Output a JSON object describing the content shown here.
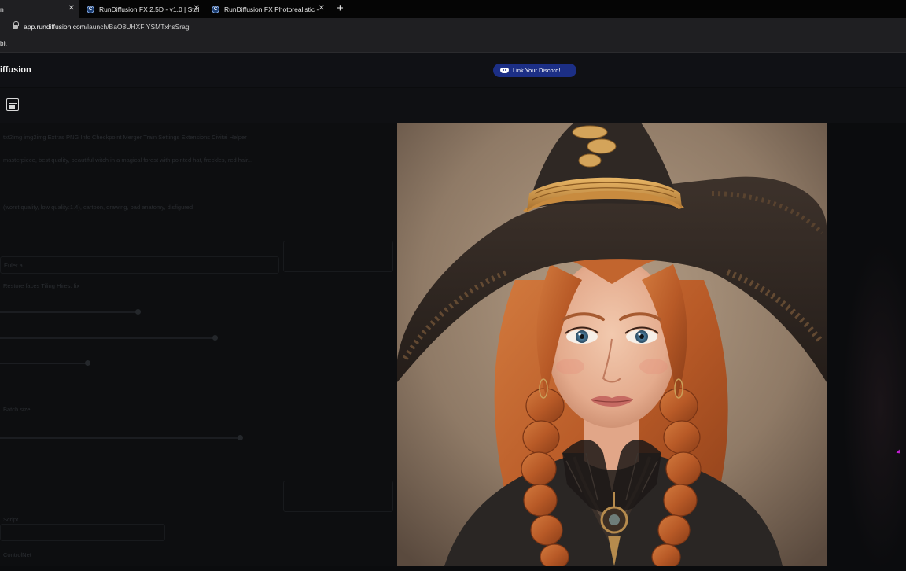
{
  "browser": {
    "tabs": [
      {
        "title": "n",
        "active": true
      },
      {
        "title": "RunDiffusion FX 2.5D - v1.0 | Stal",
        "active": false
      },
      {
        "title": "RunDiffusion FX Photorealistic - ",
        "active": false
      }
    ],
    "favicon_letter": "C",
    "url_host": "app.rundiffusion.com",
    "url_path": "/launch/BaO8UHXFIYSMTxhsSrag",
    "bookmark": "bit"
  },
  "app": {
    "brand": "iffusion",
    "discord_label": "Link Your Discord!"
  },
  "dimmed_ui": {
    "tabs_row": "txt2img   img2img   Extras   PNG Info   Checkpoint Merger   Train   Settings   Extensions   Civitai Helper",
    "prompt": "masterpiece, best quality, beautiful witch in a magical forest with pointed hat, freckles, red hair...",
    "negative": "(worst quality, low quality:1.4), cartoon, drawing, bad anatomy, disfigured",
    "sampler": "Euler a",
    "restore": "Restore faces    Tiling    Hires. fix",
    "batch": "Batch size",
    "seed": "Seed",
    "script": "Script",
    "controlnet": "ControlNet"
  },
  "colors": {
    "accent_green": "#2b6a4e",
    "discord_blue": "#1c2f86",
    "cursor_magenta": "#c21fd1"
  },
  "icons": [
    "lock-icon",
    "close-icon",
    "plus-icon",
    "discord-icon",
    "save-icon",
    "cursor-icon"
  ]
}
